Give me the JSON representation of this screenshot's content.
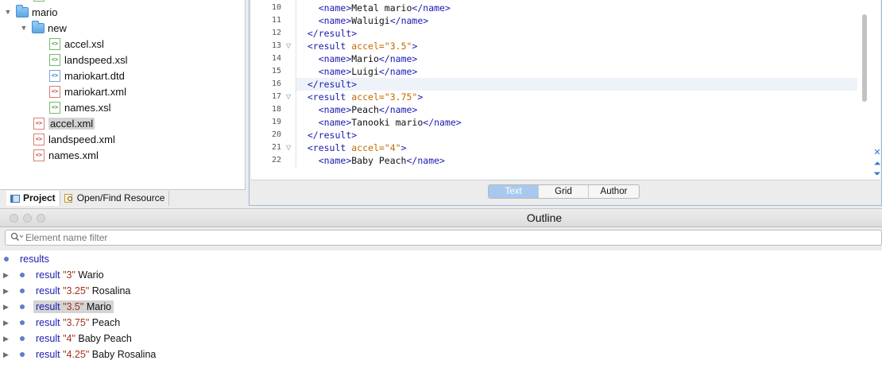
{
  "project_tree": {
    "items": [
      {
        "label": "mario",
        "type": "folder",
        "depth": 0,
        "expanded": true
      },
      {
        "label": "new",
        "type": "folder",
        "depth": 1,
        "expanded": true
      },
      {
        "label": "accel.xsl",
        "type": "xsl",
        "depth": 2
      },
      {
        "label": "landspeed.xsl",
        "type": "xsl",
        "depth": 2
      },
      {
        "label": "mariokart.dtd",
        "type": "dtd",
        "depth": 2
      },
      {
        "label": "mariokart.xml",
        "type": "xml",
        "depth": 2
      },
      {
        "label": "names.xsl",
        "type": "xsl",
        "depth": 2
      },
      {
        "label": "accel.xml",
        "type": "xml",
        "depth": 1,
        "selected": true
      },
      {
        "label": "landspeed.xml",
        "type": "xml",
        "depth": 1
      },
      {
        "label": "names.xml",
        "type": "xml",
        "depth": 1
      }
    ]
  },
  "panel_tabs": [
    {
      "label": "Project",
      "active": true
    },
    {
      "label": "Open/Find Resource",
      "active": false
    }
  ],
  "editor": {
    "lines": [
      {
        "n": "10",
        "fold": false,
        "parts": [
          [
            "text",
            "    "
          ],
          [
            "tag",
            "<name>"
          ],
          [
            "text",
            "Metal mario"
          ],
          [
            "tag",
            "</name>"
          ]
        ]
      },
      {
        "n": "11",
        "fold": false,
        "parts": [
          [
            "text",
            "    "
          ],
          [
            "tag",
            "<name>"
          ],
          [
            "text",
            "Waluigi"
          ],
          [
            "tag",
            "</name>"
          ]
        ]
      },
      {
        "n": "12",
        "fold": false,
        "parts": [
          [
            "text",
            "  "
          ],
          [
            "tag",
            "</result>"
          ]
        ]
      },
      {
        "n": "13",
        "fold": true,
        "parts": [
          [
            "text",
            "  "
          ],
          [
            "tag",
            "<result"
          ],
          [
            "text",
            " "
          ],
          [
            "attr",
            "accel=\"3.5\""
          ],
          [
            "tag",
            ">"
          ]
        ]
      },
      {
        "n": "14",
        "fold": false,
        "parts": [
          [
            "text",
            "    "
          ],
          [
            "tag",
            "<name>"
          ],
          [
            "text",
            "Mario"
          ],
          [
            "tag",
            "</name>"
          ]
        ]
      },
      {
        "n": "15",
        "fold": false,
        "parts": [
          [
            "text",
            "    "
          ],
          [
            "tag",
            "<name>"
          ],
          [
            "text",
            "Luigi"
          ],
          [
            "tag",
            "</name>"
          ]
        ]
      },
      {
        "n": "16",
        "fold": false,
        "current": true,
        "parts": [
          [
            "text",
            "  "
          ],
          [
            "tag",
            "</result>"
          ]
        ]
      },
      {
        "n": "17",
        "fold": true,
        "parts": [
          [
            "text",
            "  "
          ],
          [
            "tag",
            "<result"
          ],
          [
            "text",
            " "
          ],
          [
            "attr",
            "accel=\"3.75\""
          ],
          [
            "tag",
            ">"
          ]
        ]
      },
      {
        "n": "18",
        "fold": false,
        "parts": [
          [
            "text",
            "    "
          ],
          [
            "tag",
            "<name>"
          ],
          [
            "text",
            "Peach"
          ],
          [
            "tag",
            "</name>"
          ]
        ]
      },
      {
        "n": "19",
        "fold": false,
        "parts": [
          [
            "text",
            "    "
          ],
          [
            "tag",
            "<name>"
          ],
          [
            "text",
            "Tanooki mario"
          ],
          [
            "tag",
            "</name>"
          ]
        ]
      },
      {
        "n": "20",
        "fold": false,
        "parts": [
          [
            "text",
            "  "
          ],
          [
            "tag",
            "</result>"
          ]
        ]
      },
      {
        "n": "21",
        "fold": true,
        "parts": [
          [
            "text",
            "  "
          ],
          [
            "tag",
            "<result"
          ],
          [
            "text",
            " "
          ],
          [
            "attr",
            "accel=\"4\""
          ],
          [
            "tag",
            ">"
          ]
        ]
      },
      {
        "n": "22",
        "fold": false,
        "parts": [
          [
            "text",
            "    "
          ],
          [
            "tag",
            "<name>"
          ],
          [
            "text",
            "Baby Peach"
          ],
          [
            "tag",
            "</name>"
          ]
        ]
      }
    ],
    "mode_tabs": [
      {
        "label": "Text",
        "active": true
      },
      {
        "label": "Grid",
        "active": false
      },
      {
        "label": "Author",
        "active": false
      }
    ]
  },
  "outline": {
    "title": "Outline",
    "filter_placeholder": "Element name filter",
    "items": [
      {
        "el": "results",
        "val": "",
        "text": "",
        "root": true
      },
      {
        "el": "result",
        "val": "\"3\"",
        "text": "Wario"
      },
      {
        "el": "result",
        "val": "\"3.25\"",
        "text": "Rosalina"
      },
      {
        "el": "result",
        "val": "\"3.5\"",
        "text": "Mario",
        "selected": true
      },
      {
        "el": "result",
        "val": "\"3.75\"",
        "text": "Peach"
      },
      {
        "el": "result",
        "val": "\"4\"",
        "text": "Baby Peach"
      },
      {
        "el": "result",
        "val": "\"4.25\"",
        "text": "Baby Rosalina"
      }
    ]
  },
  "colors": {
    "tag": "#1a1ab0",
    "attribute": "#c46a00",
    "outline_value": "#a4341a",
    "active_tab": "#a9c8ee"
  }
}
